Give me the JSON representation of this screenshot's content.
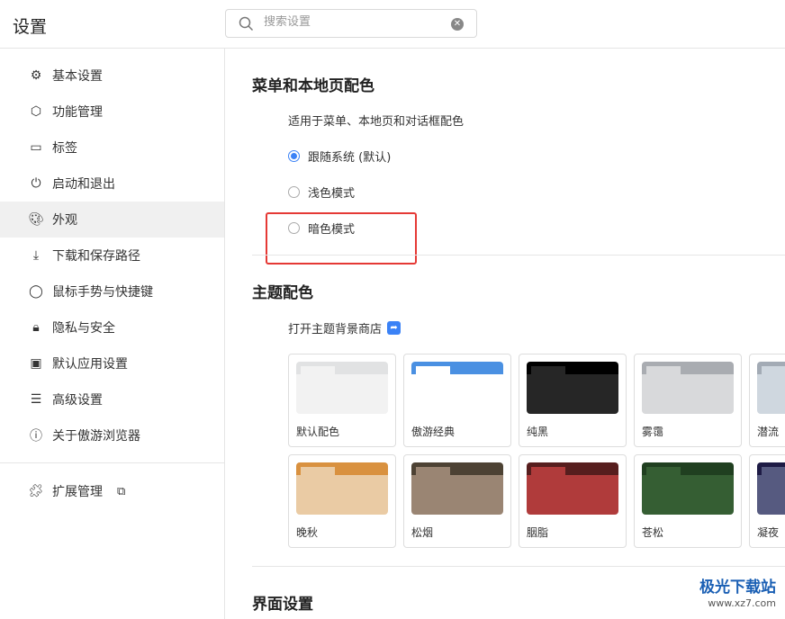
{
  "header": {
    "title": "设置",
    "search_placeholder": "搜索设置"
  },
  "sidebar": {
    "items": [
      {
        "label": "基本设置",
        "icon": "gear-icon"
      },
      {
        "label": "功能管理",
        "icon": "cube-icon"
      },
      {
        "label": "标签",
        "icon": "tab-icon"
      },
      {
        "label": "启动和退出",
        "icon": "power-icon"
      },
      {
        "label": "外观",
        "icon": "palette-icon",
        "active": true
      },
      {
        "label": "下载和保存路径",
        "icon": "download-folder-icon"
      },
      {
        "label": "鼠标手势与快捷键",
        "icon": "mouse-icon"
      },
      {
        "label": "隐私与安全",
        "icon": "lock-icon"
      },
      {
        "label": "默认应用设置",
        "icon": "default-app-icon"
      },
      {
        "label": "高级设置",
        "icon": "sliders-icon"
      },
      {
        "label": "关于傲游浏览器",
        "icon": "info-icon"
      }
    ],
    "extensions": "扩展管理"
  },
  "menu_color": {
    "title": "菜单和本地页配色",
    "desc": "适用于菜单、本地页和对话框配色",
    "options": [
      "跟随系统 (默认)",
      "浅色模式",
      "暗色模式"
    ],
    "selected": 0
  },
  "theme": {
    "title": "主题配色",
    "store_link": "打开主题背景商店",
    "themes": [
      {
        "name": "默认配色",
        "bar": "#e1e2e3",
        "tab": "#f2f2f2",
        "body": "#f2f2f2"
      },
      {
        "name": "傲游经典",
        "bar": "#4a90e2",
        "tab": "#ffffff",
        "body": "#ffffff"
      },
      {
        "name": "纯黑",
        "bar": "#000000",
        "tab": "#262626",
        "body": "#262626"
      },
      {
        "name": "雾霭",
        "bar": "#a9acb1",
        "tab": "#d8d9db",
        "body": "#d8d9db"
      },
      {
        "name": "潜流",
        "bar": "#a3abb5",
        "tab": "#cfd7df",
        "body": "#cfd7df"
      },
      {
        "name": "晚秋",
        "bar": "#d9913f",
        "tab": "#eacba4",
        "body": "#eacba4"
      },
      {
        "name": "松烟",
        "bar": "#4d4234",
        "tab": "#9a8573",
        "body": "#9a8573"
      },
      {
        "name": "胭脂",
        "bar": "#571e1e",
        "tab": "#b03b3b",
        "body": "#b03b3b"
      },
      {
        "name": "苍松",
        "bar": "#203f20",
        "tab": "#355e33",
        "body": "#355e33"
      },
      {
        "name": "凝夜",
        "bar": "#1e1b45",
        "tab": "#565a80",
        "body": "#565a80"
      }
    ]
  },
  "interface": {
    "title": "界面设置"
  },
  "watermark": {
    "name": "极光下载站",
    "url": "www.xz7.com"
  }
}
